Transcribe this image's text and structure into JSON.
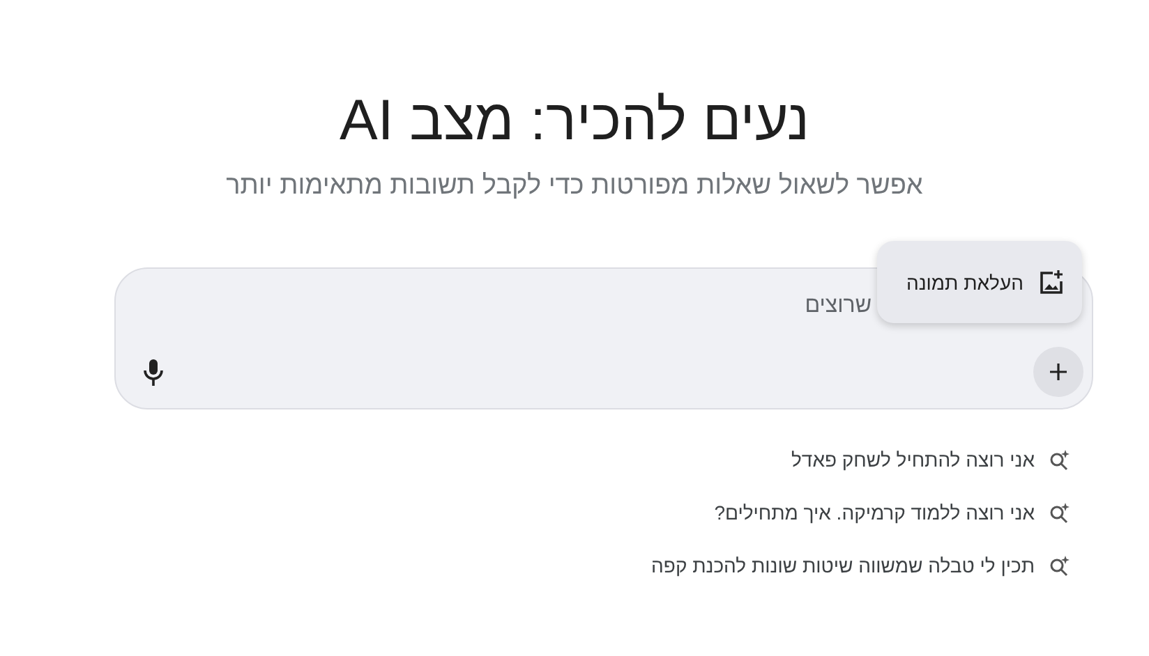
{
  "title": "נעים להכיר: מצב AI",
  "subtitle": "אפשר לשאול שאלות מפורטות כדי לקבל תשובות מתאימות יותר",
  "input": {
    "placeholder": "שרוצים"
  },
  "menu": {
    "items": [
      {
        "label": "העלאת תמונה"
      }
    ]
  },
  "suggestions": [
    {
      "text": "אני רוצה להתחיל לשחק פאדל"
    },
    {
      "text": "אני רוצה ללמוד קרמיקה. איך מתחילים?"
    },
    {
      "text": "תכין לי טבלה שמשווה שיטות שונות להכנת קפה"
    }
  ]
}
